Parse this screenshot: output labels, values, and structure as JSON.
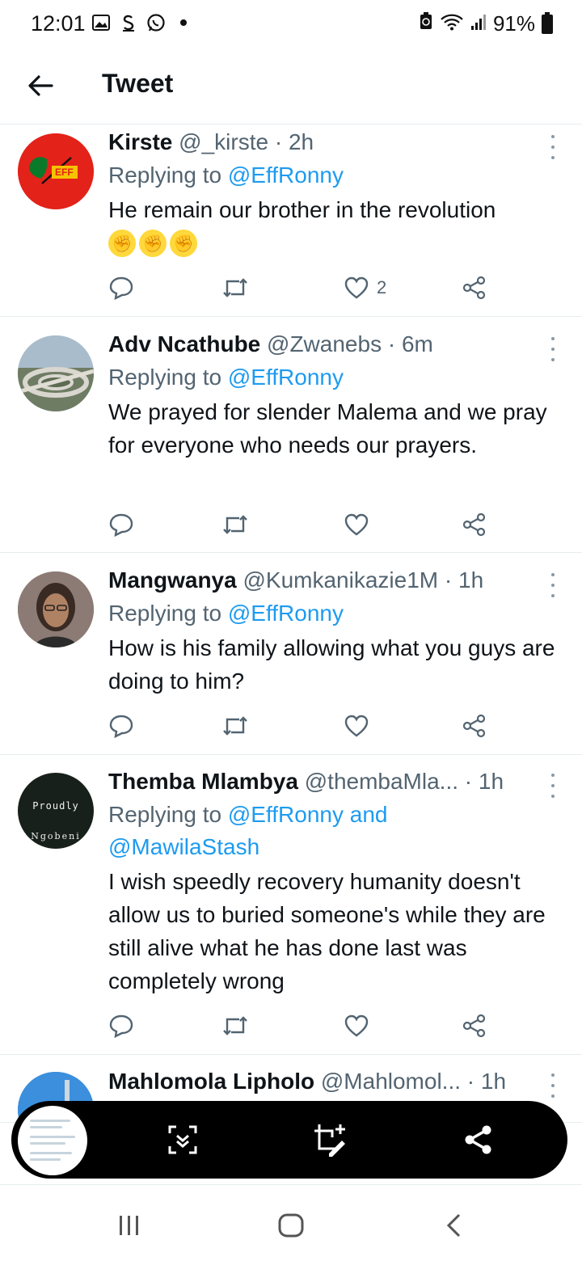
{
  "status_bar": {
    "time": "12:01",
    "battery": "91%",
    "left_icons": [
      "gallery-icon",
      "payment-icon",
      "whatsapp-icon",
      "dot-icon"
    ],
    "right_icons": [
      "battery-saver-icon",
      "wifi-icon",
      "signal-icon",
      "battery-icon"
    ]
  },
  "header": {
    "title": "Tweet",
    "back_icon": "arrow-left-icon"
  },
  "tweets": [
    {
      "name": "Kirste",
      "handle": "@_kirste",
      "time": "· 2h",
      "replying_prefix": "Replying to ",
      "replying_to": "@EffRonny",
      "text": "He remain our brother in the revolution",
      "emojis": [
        "✊",
        "✊",
        "✊"
      ],
      "likes": "2",
      "avatar_text": "EFF"
    },
    {
      "name": "Adv Ncathube",
      "handle": "@Zwanebs",
      "time": "· 6m",
      "replying_prefix": "Replying to ",
      "replying_to": "@EffRonny",
      "text": "We prayed for slender Malema and we pray for everyone who needs our prayers.",
      "likes": ""
    },
    {
      "name": "Mangwanya",
      "handle": "@Kumkanikazie1M",
      "time": "· 1h",
      "replying_prefix": "Replying to ",
      "replying_to": "@EffRonny",
      "text": "How is his family allowing what you guys are doing to him?",
      "likes": ""
    },
    {
      "name": "Themba Mlambya",
      "handle": "@thembaMla...",
      "time": "· 1h",
      "replying_prefix": "Replying to ",
      "replying_to": "@EffRonny and @MawilaStash",
      "text": "I wish speedly recovery humanity doesn't allow us to buried someone's while they are still alive what he has done last was completely wrong",
      "likes": "",
      "avatar_line1": "Proudly",
      "avatar_line2": "Ngobeni"
    },
    {
      "name": "Mahlomola Lipholo",
      "handle": "@Mahlomol...",
      "time": "· 1h"
    }
  ],
  "screenshot_toolbar": {
    "icons": [
      "screenshot-thumbnail",
      "scroll-capture-icon",
      "edit-crop-icon",
      "share-icon"
    ]
  },
  "nav_bar": {
    "icons": [
      "recents-icon",
      "home-icon",
      "back-icon"
    ]
  },
  "colors": {
    "accent": "#1d9bf0",
    "text": "#0f1419",
    "muted": "#536471",
    "divider": "#e6ecf0"
  }
}
